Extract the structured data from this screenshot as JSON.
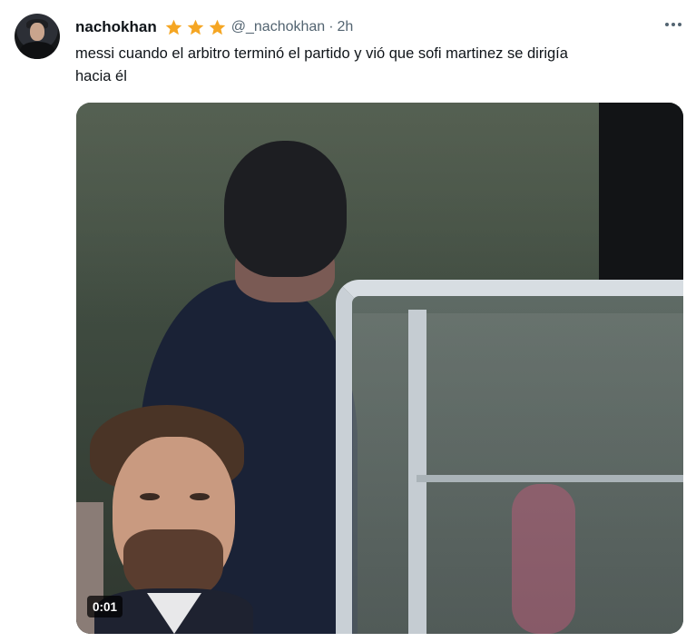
{
  "tweet": {
    "author_name": "nachokhan",
    "handle": "@_nachokhan",
    "separator": "·",
    "time": "2h",
    "text": "messi cuando el arbitro terminó el partido y vió que sofi martinez se dirigía\nhacia él",
    "badges": [
      "star-icon",
      "star-icon",
      "star-icon"
    ],
    "badge_color": "#f5a623"
  },
  "media": {
    "type": "video",
    "duration": "0:01"
  }
}
